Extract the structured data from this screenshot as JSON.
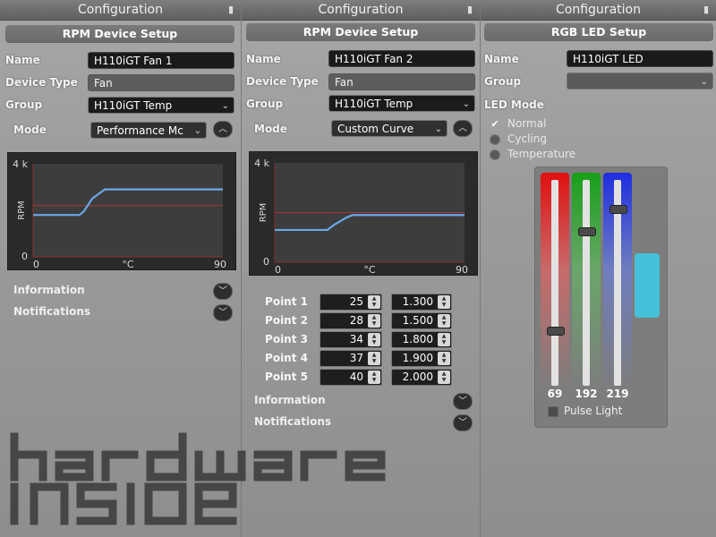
{
  "panel1": {
    "title": "Configuration",
    "section": "RPM Device Setup",
    "fields": {
      "name_label": "Name",
      "name_value": "H110iGT Fan 1",
      "type_label": "Device Type",
      "type_value": "Fan",
      "group_label": "Group",
      "group_value": "H110iGT Temp",
      "mode_label": "Mode",
      "mode_value": "Performance Mc"
    },
    "chart_data": {
      "type": "line",
      "ylabel": "RPM",
      "xlabel": "°C",
      "y_top_label": "4 k",
      "y_bottom_label": "0",
      "x_left_label": "0",
      "x_right_label": "90",
      "xlim": [
        0,
        90
      ],
      "ylim": [
        0,
        4000
      ],
      "threshold_rpm": 2200,
      "x": [
        0,
        22,
        24,
        28,
        34,
        90
      ],
      "y": [
        1800,
        1800,
        1950,
        2500,
        2900,
        2900
      ]
    },
    "information_label": "Information",
    "notifications_label": "Notifications"
  },
  "panel2": {
    "title": "Configuration",
    "section": "RPM Device Setup",
    "fields": {
      "name_label": "Name",
      "name_value": "H110iGT Fan 2",
      "type_label": "Device Type",
      "type_value": "Fan",
      "group_label": "Group",
      "group_value": "H110iGT Temp",
      "mode_label": "Mode",
      "mode_value": "Custom Curve"
    },
    "chart_data": {
      "type": "line",
      "ylabel": "RPM",
      "xlabel": "°C",
      "y_top_label": "4 k",
      "y_bottom_label": "0",
      "x_left_label": "0",
      "x_right_label": "90",
      "xlim": [
        0,
        90
      ],
      "ylim": [
        0,
        4000
      ],
      "threshold_rpm": 2000,
      "x": [
        0,
        25,
        28,
        34,
        37,
        90
      ],
      "y": [
        1300,
        1300,
        1500,
        1800,
        1900,
        1900
      ]
    },
    "points": [
      {
        "label": "Point 1",
        "temp": "25",
        "rpm": "1.300"
      },
      {
        "label": "Point 2",
        "temp": "28",
        "rpm": "1.500"
      },
      {
        "label": "Point 3",
        "temp": "34",
        "rpm": "1.800"
      },
      {
        "label": "Point 4",
        "temp": "37",
        "rpm": "1.900"
      },
      {
        "label": "Point 5",
        "temp": "40",
        "rpm": "2.000"
      }
    ],
    "information_label": "Information",
    "notifications_label": "Notifications"
  },
  "panel3": {
    "title": "Configuration",
    "section": "RGB LED Setup",
    "name_label": "Name",
    "name_value": "H110iGT LED",
    "group_label": "Group",
    "group_value": "",
    "led_mode_label": "LED Mode",
    "modes": [
      {
        "label": "Normal",
        "selected": true
      },
      {
        "label": "Cycling",
        "selected": false
      },
      {
        "label": "Temperature",
        "selected": false
      }
    ],
    "rgb": {
      "r": "69",
      "g": "192",
      "b": "219"
    },
    "rgb_levels": {
      "r": 69,
      "g": 192,
      "b": 219,
      "max": 255
    },
    "swatch_color": "#45c0db",
    "pulse_label": "Pulse Light"
  },
  "colors": {
    "curve": "#6aa8e8",
    "threshold": "#a33a3a",
    "axis": "#8a3030"
  },
  "watermark": "hardware inside"
}
